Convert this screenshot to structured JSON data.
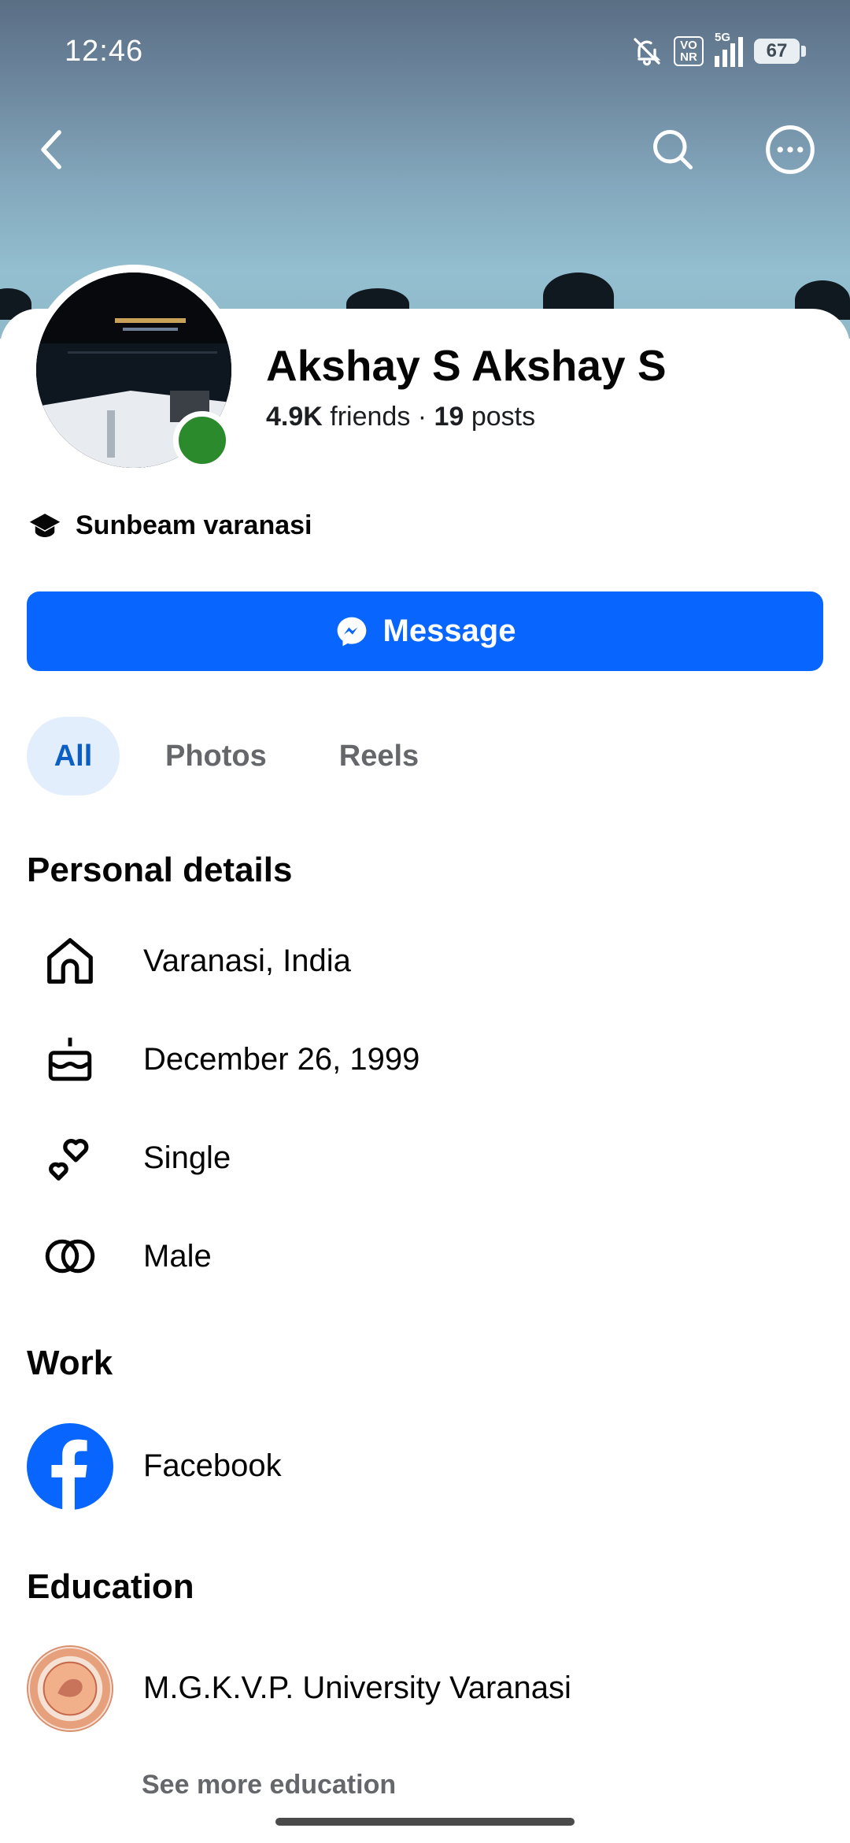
{
  "status_bar": {
    "time": "12:46",
    "volte_label": "VO NR",
    "network_label": "5G",
    "battery_level": "67"
  },
  "profile": {
    "name": "Akshay S Akshay S",
    "friends_count": "4.9K",
    "friends_label": " friends",
    "separator": " · ",
    "posts_count": "19",
    "posts_label": " posts",
    "school": "Sunbeam varanasi",
    "online_status_color": "#2b8a2b"
  },
  "actions": {
    "message_label": "Message",
    "accent_color": "#0866ff"
  },
  "tabs": [
    {
      "label": "All",
      "active": true
    },
    {
      "label": "Photos",
      "active": false
    },
    {
      "label": "Reels",
      "active": false
    }
  ],
  "personal_details": {
    "title": "Personal details",
    "items": [
      {
        "icon": "home-icon",
        "text": "Varanasi, India"
      },
      {
        "icon": "birthday-cake-icon",
        "text": "December 26, 1999"
      },
      {
        "icon": "relationship-hearts-icon",
        "text": "Single"
      },
      {
        "icon": "gender-rings-icon",
        "text": "Male"
      }
    ]
  },
  "work": {
    "title": "Work",
    "items": [
      {
        "icon": "facebook-logo-icon",
        "text": "Facebook"
      }
    ]
  },
  "education": {
    "title": "Education",
    "items": [
      {
        "icon": "university-seal-icon",
        "text": "M.G.K.V.P. University Varanasi"
      }
    ],
    "see_more": "See more education"
  }
}
